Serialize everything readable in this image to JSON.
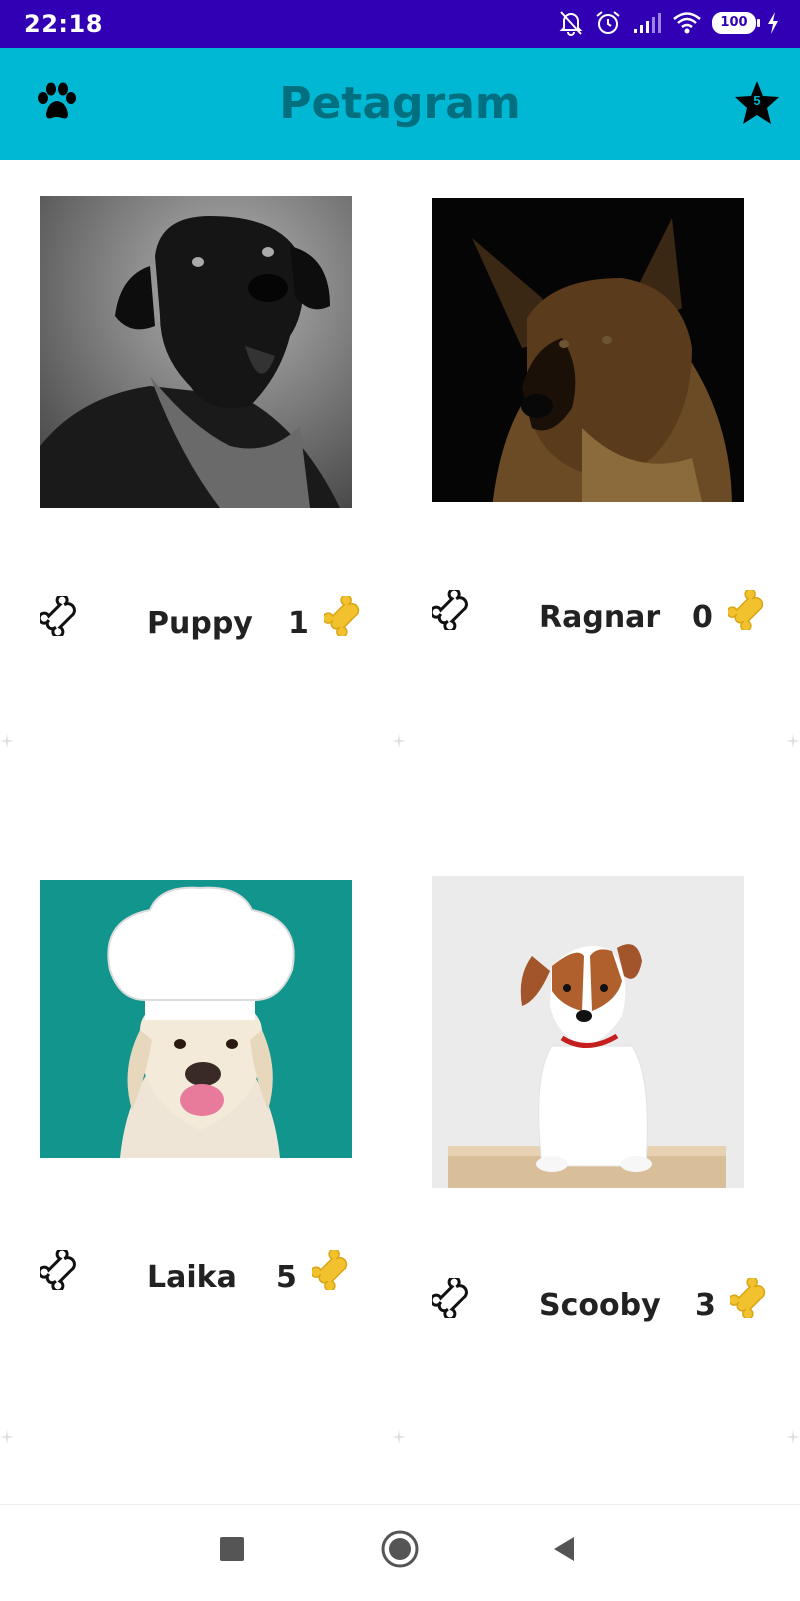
{
  "status_bar": {
    "time": "22:18",
    "battery": "100",
    "icons": [
      "bell-off-icon",
      "alarm-icon",
      "signal-icon",
      "wifi-icon",
      "battery-icon",
      "charging-icon"
    ]
  },
  "app_bar": {
    "title": "Petagram",
    "left_icon": "paw-icon",
    "right_icon": "star-icon",
    "favorites_count": "5",
    "background": "#00b8d4",
    "title_color": "#006f80"
  },
  "pets": [
    {
      "name": "Puppy",
      "likes": "1",
      "photo": "black labrador wearing plaid bandana"
    },
    {
      "name": "Ragnar",
      "likes": "0",
      "photo": "german shepherd on dark background"
    },
    {
      "name": "Laika",
      "likes": "5",
      "photo": "golden retriever wearing chef hat"
    },
    {
      "name": "Scooby",
      "likes": "3",
      "photo": "jack russell terrier sitting on wooden box"
    }
  ],
  "nav_bar": {
    "buttons": [
      "recents-square-icon",
      "home-circle-icon",
      "back-triangle-icon"
    ]
  }
}
